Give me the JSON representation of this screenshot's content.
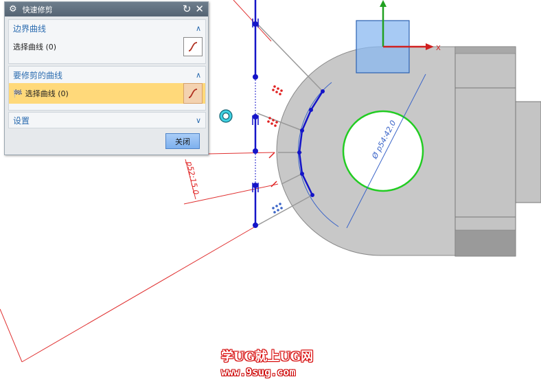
{
  "dialog": {
    "title": "快速修剪",
    "boundary_group": {
      "label": "边界曲线",
      "select_label": "选择曲线 (0)"
    },
    "trim_group": {
      "label": "要修剪的曲线",
      "select_label": "选择曲线 (0)"
    },
    "settings_group": {
      "label": "设置"
    },
    "close_label": "关闭"
  },
  "canvas": {
    "dimension_hole": "Ø p54:42.0",
    "dimension_offset": "p52:15.0",
    "axis_x_label": "X"
  },
  "watermark": {
    "line1": "学UG就上UG网",
    "line2": "www.9sug.com"
  },
  "colors": {
    "sketch_blue": "#1414c8",
    "dimension_red": "#e02020",
    "part_gray": "#c8c8c8",
    "hole_green": "#22cc22"
  }
}
